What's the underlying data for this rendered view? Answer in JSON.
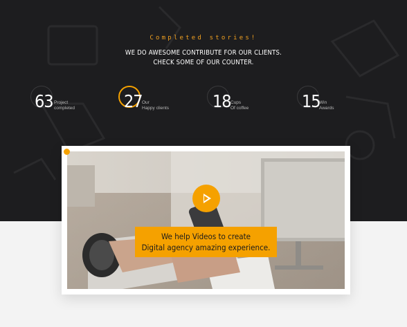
{
  "section": {
    "eyebrow": "Completed stories!",
    "headline_line1": "WE DO AWESOME CONTRIBUTE FOR OUR CLIENTS.",
    "headline_line2": "CHECK SOME OF OUR COUNTER."
  },
  "counters": [
    {
      "value": "63",
      "label_line1": "Project",
      "label_line2": "completed",
      "highlighted": false
    },
    {
      "value": "27",
      "label_line1": "Our",
      "label_line2": "Happy clients",
      "highlighted": true
    },
    {
      "value": "18",
      "label_line1": "Cups",
      "label_line2": "Of coffee",
      "highlighted": false
    },
    {
      "value": "15",
      "label_line1": "Win",
      "label_line2": "Awards",
      "highlighted": false
    }
  ],
  "video": {
    "caption_line1": "We help Videos to create",
    "caption_line2": "Digital agency amazing experience."
  },
  "colors": {
    "accent": "#f5a100",
    "dark_background": "#1d1d1f",
    "light_background": "#f3f3f3"
  },
  "icons": {
    "play": "play-icon"
  }
}
